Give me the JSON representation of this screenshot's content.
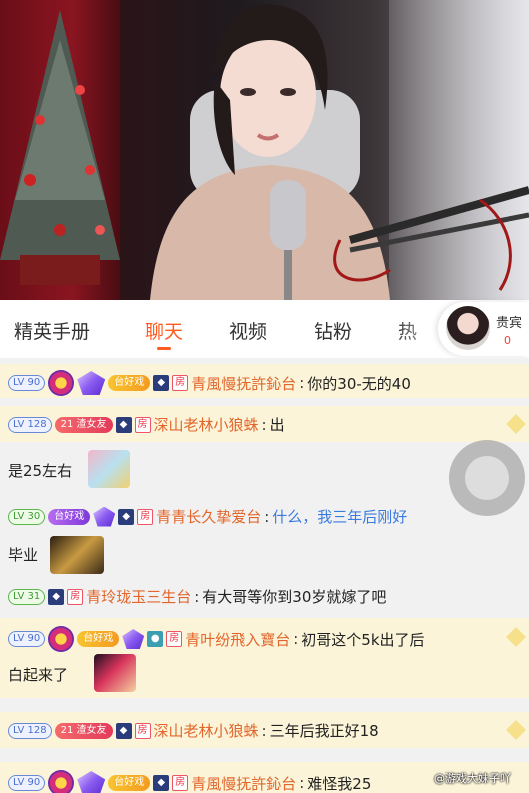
{
  "tabs": {
    "items": [
      "精英手册",
      "聊天",
      "视频",
      "钻粉",
      "热"
    ],
    "active": "聊天"
  },
  "host": {
    "label": "贵宾",
    "count": "0"
  },
  "chat": {
    "messages": [
      {
        "level": "LV 90",
        "badge": "台好戏",
        "name": "青風慢抚許鈊台",
        "text": "你的30-无的40"
      },
      {
        "level": "LV 128",
        "badge": "渣女友",
        "name": "深山老林小狼蛛",
        "text": "出"
      },
      {
        "text": "是25左右"
      },
      {
        "level": "LV 30",
        "badge": "台好戏",
        "name": "青青长久挚爱台",
        "text": "什么，我三年后刚好"
      },
      {
        "text": "毕业"
      },
      {
        "level": "LV 31",
        "name": "青玲珑玉三生台",
        "text": "有大哥等你到30岁就嫁了吧"
      },
      {
        "level": "LV 90",
        "badge": "台好戏",
        "name": "青叶纷飛入寶台",
        "text": "初哥这个5k出了后"
      },
      {
        "text": "白起来了"
      },
      {
        "level": "LV 128",
        "badge": "渣女友",
        "name": "深山老林小狼蛛",
        "text": "三年后我正好18"
      },
      {
        "level": "LV 90",
        "badge": "台好戏",
        "name": "青風慢抚許鈊台",
        "text": "难怪我25"
      }
    ],
    "room_tag": "房",
    "badge_number": "21",
    "separator": ":"
  },
  "watermark": "@游戏大妹子吖",
  "colors": {
    "accent": "#ff5a1f",
    "name": "#e2662b",
    "highlight_row": "#fbf4d8",
    "blue_text": "#3a7be0"
  }
}
